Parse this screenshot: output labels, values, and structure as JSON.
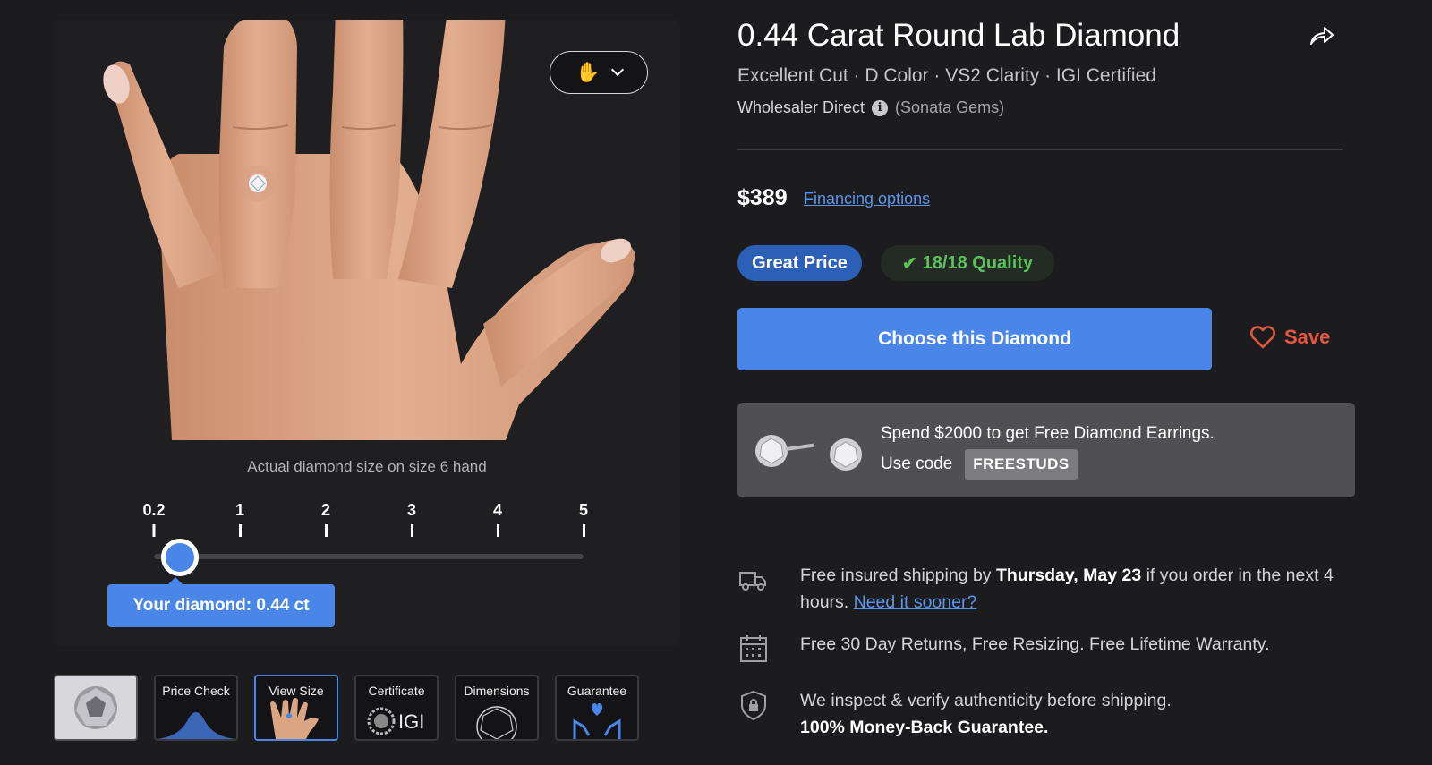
{
  "viewer": {
    "caption": "Actual diamond size on size 6 hand",
    "scale_ticks": [
      "0.2",
      "1",
      "2",
      "3",
      "4",
      "5"
    ],
    "tooltip": "Your diamond: 0.44 ct",
    "selected_carat": 0.44,
    "scale_min": 0.2,
    "scale_max": 5
  },
  "thumbnails": [
    {
      "label": "",
      "kind": "diamond-photo"
    },
    {
      "label": "Price Check",
      "kind": "price-check"
    },
    {
      "label": "View Size",
      "kind": "view-size"
    },
    {
      "label": "Certificate",
      "kind": "certificate",
      "sublabel": "IGI"
    },
    {
      "label": "Dimensions",
      "kind": "dimensions"
    },
    {
      "label": "Guarantee",
      "kind": "guarantee"
    }
  ],
  "product": {
    "title": "0.44 Carat Round Lab Diamond",
    "subtitle": "Excellent Cut · D Color · VS2 Clarity · IGI Certified",
    "seller": "Wholesaler Direct",
    "seller_brand": "(Sonata Gems)",
    "price": "$389",
    "financing": "Financing options",
    "badge_price": "Great Price",
    "badge_quality": "18/18 Quality",
    "cta": "Choose this Diamond",
    "save": "Save"
  },
  "promo": {
    "line1": "Spend $2000 to get Free Diamond Earrings.",
    "code_prefix": "Use code",
    "code": "FREESTUDS"
  },
  "features": {
    "shipping_a": "Free insured shipping by ",
    "shipping_bold": "Thursday, May 23",
    "shipping_b": " if you order in the next 4 hours. ",
    "shipping_link": "Need it sooner?",
    "returns": "Free 30 Day Returns, Free Resizing. Free Lifetime Warranty.",
    "inspect": "We inspect & verify authenticity before shipping.",
    "guarantee": "100% Money-Back Guarantee."
  },
  "colors": {
    "accent": "#4a86e8",
    "save": "#e5573f",
    "quality": "#59c25a"
  }
}
